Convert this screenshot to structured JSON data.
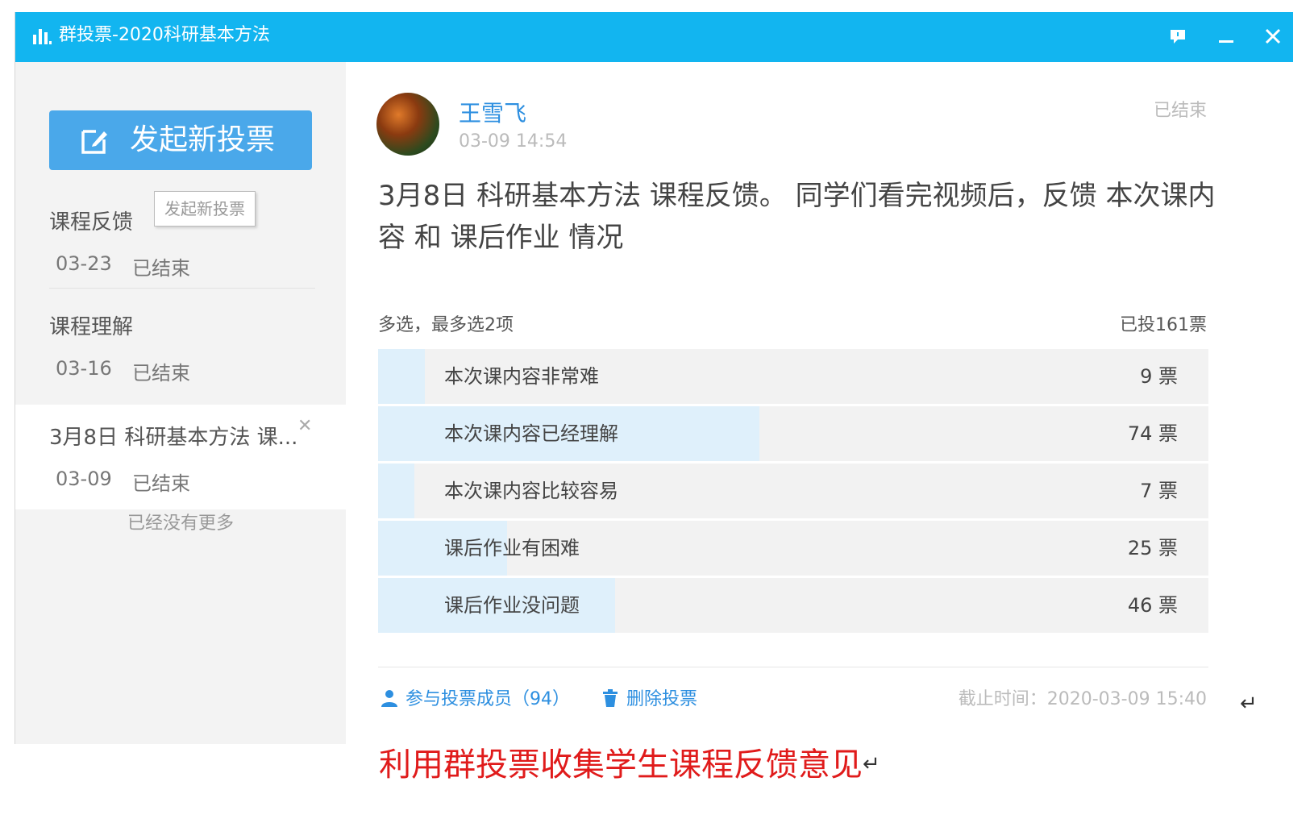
{
  "window": {
    "title": "群投票-2020科研基本方法"
  },
  "sidebar": {
    "new_vote_label": "发起新投票",
    "tooltip": "发起新投票",
    "items": [
      {
        "title": "课程反馈",
        "date": "03-23",
        "status": "已结束"
      },
      {
        "title": "课程理解",
        "date": "03-16",
        "status": "已结束"
      },
      {
        "title": "3月8日 科研基本方法 课...",
        "date": "03-09",
        "status": "已结束"
      }
    ],
    "no_more": "已经没有更多"
  },
  "post": {
    "author": "王雪飞",
    "time": "03-09 14:54",
    "status": "已结束",
    "question": "3月8日 科研基本方法 课程反馈。 同学们看完视频后，反馈 本次课内容 和 课后作业 情况",
    "rule": "多选，最多选2项",
    "total": "已投161票",
    "options": [
      {
        "label": "本次课内容非常难",
        "count": "9 票",
        "votes": 9
      },
      {
        "label": "本次课内容已经理解",
        "count": "74 票",
        "votes": 74
      },
      {
        "label": "本次课内容比较容易",
        "count": "7 票",
        "votes": 7
      },
      {
        "label": "课后作业有困难",
        "count": "25 票",
        "votes": 25
      },
      {
        "label": "课后作业没问题",
        "count": "46 票",
        "votes": 46
      }
    ],
    "members_link": "参与投票成员（94）",
    "delete_link": "删除投票",
    "deadline": "截止时间：2020-03-09 15:40"
  },
  "caption": {
    "text": "利用群投票收集学生课程反馈意见",
    "return_mark": "↵"
  },
  "colors": {
    "titlebar": "#12b5f0",
    "button": "#4aa8ea",
    "link": "#2d8fe0",
    "bar_fill": "#dff0fb",
    "caption": "#e01b1b"
  }
}
